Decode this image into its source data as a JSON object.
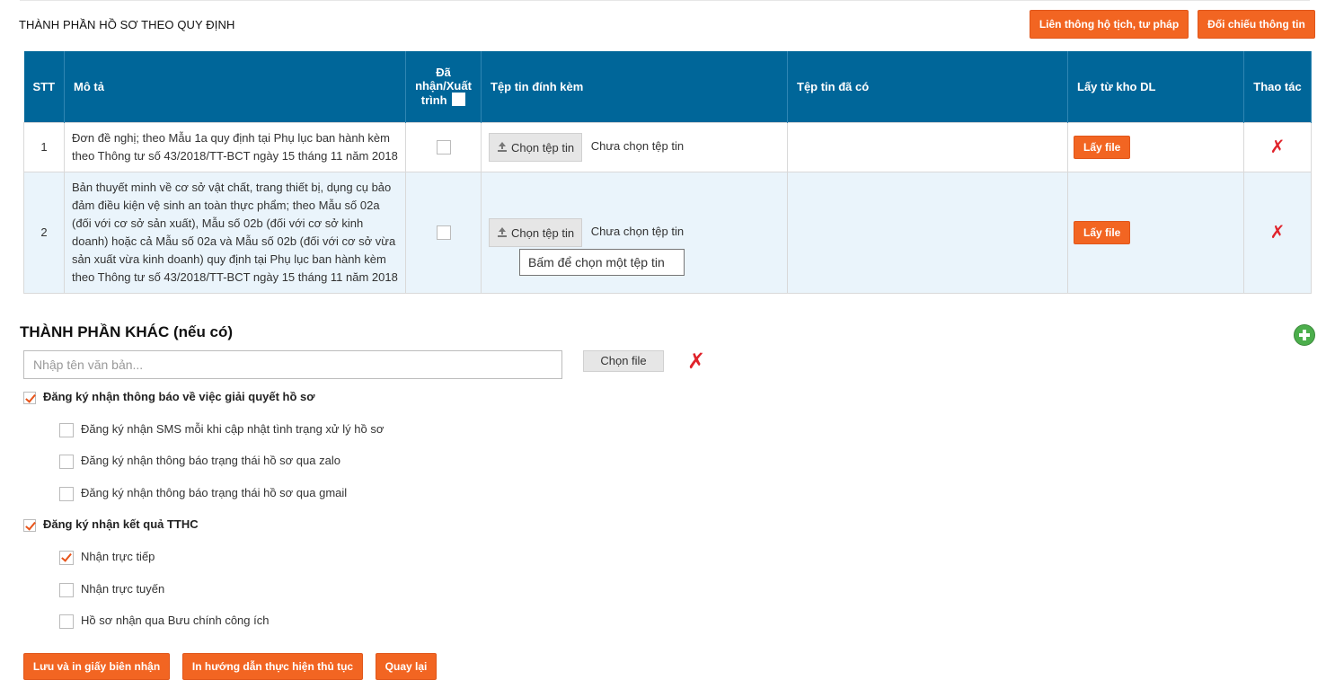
{
  "header": {
    "title": "THÀNH PHẦN HỒ SƠ THEO QUY ĐỊNH",
    "btn_lien_thong": "Liên thông hộ tịch, tư pháp",
    "btn_doi_chieu": "Đối chiếu thông tin"
  },
  "table": {
    "headers": {
      "stt": "STT",
      "mo_ta": "Mô tả",
      "da_nhan": "Đã nhận/Xuất trình",
      "tep_dinh_kem": "Tệp tin đính kèm",
      "tep_da_co": "Tệp tin đã có",
      "lay_tu_kho": "Lấy từ kho DL",
      "thao_tac": "Thao tác"
    },
    "rows": [
      {
        "stt": "1",
        "mo_ta": "Đơn đề nghị; theo Mẫu 1a quy định tại Phụ lục ban hành kèm theo Thông tư số 43/2018/TT-BCT ngày 15 tháng 11 năm 2018",
        "choose_label": "Chọn tệp tin",
        "no_file": "Chưa chọn tệp tin",
        "get_file": "Lấy file"
      },
      {
        "stt": "2",
        "mo_ta": "Bản thuyết minh về cơ sở vật chất, trang thiết bị, dụng cụ bảo đảm điều kiện vệ sinh an toàn thực phẩm; theo Mẫu số 02a (đối với cơ sở sản xuất), Mẫu số 02b (đối với cơ sở kinh doanh) hoặc cả Mẫu số 02a và Mẫu số 02b (đối với cơ sở vừa sản xuất vừa kinh doanh) quy định tại Phụ lục ban hành kèm theo Thông tư số 43/2018/TT-BCT ngày 15 tháng 11 năm 2018",
        "choose_label": "Chọn tệp tin",
        "no_file": "Chưa chọn tệp tin",
        "get_file": "Lấy file"
      }
    ],
    "tooltip": "Bấm để chọn một tệp tin"
  },
  "other": {
    "title": "THÀNH PHẦN KHÁC (nếu có)",
    "input_placeholder": "Nhập tên văn bản...",
    "choose_file": "Chọn file"
  },
  "options": {
    "notify_group": "Đăng ký nhận thông báo về việc giải quyết hồ sơ",
    "notify_sms": "Đăng ký nhận SMS mỗi khi cập nhật tình trạng xử lý hồ sơ",
    "notify_zalo": "Đăng ký nhận thông báo trạng thái hồ sơ qua zalo",
    "notify_gmail": "Đăng ký nhận thông báo trạng thái hồ sơ qua gmail",
    "result_group": "Đăng ký nhận kết quả TTHC",
    "result_direct": "Nhận trực tiếp",
    "result_online": "Nhận trực tuyến",
    "result_post": "Hồ sơ nhận qua Bưu chính công ích"
  },
  "footer": {
    "save_print": "Lưu và in giấy biên nhận",
    "print_guide": "In hướng dẫn thực hiện thủ tục",
    "back": "Quay lại"
  },
  "colors": {
    "accent": "#f26522",
    "table_header": "#006699",
    "row_alt": "#eaf4fb",
    "delete": "#e0232b",
    "add": "#4cae4c"
  }
}
